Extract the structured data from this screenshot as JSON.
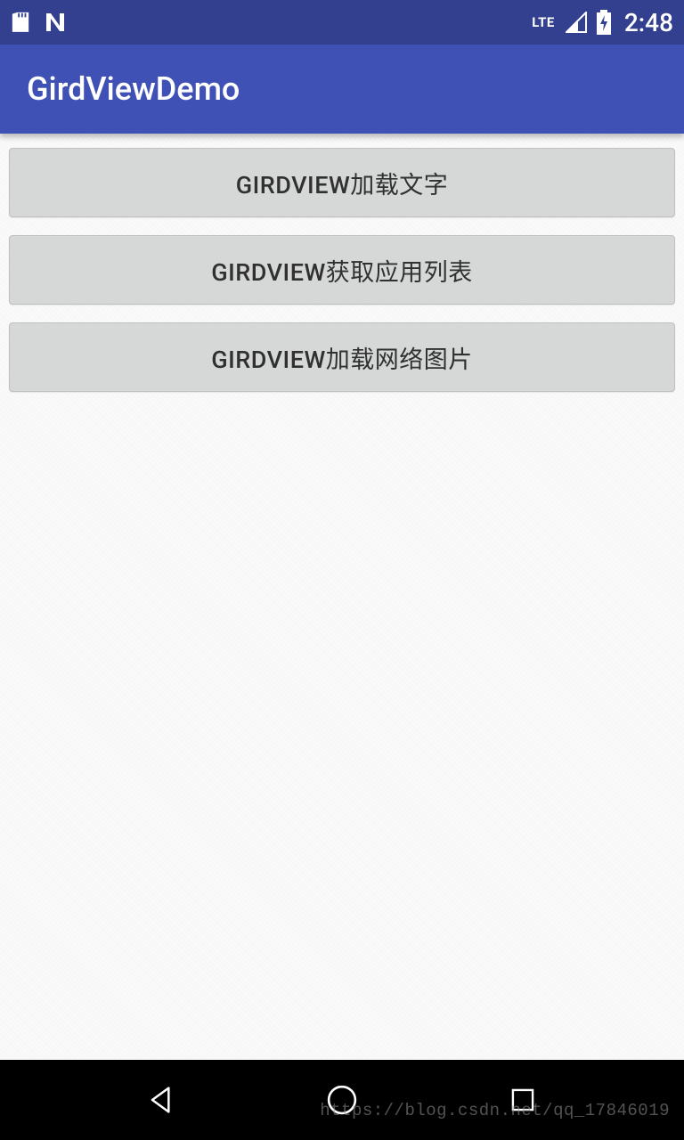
{
  "status_bar": {
    "network_label": "LTE",
    "time": "2:48"
  },
  "app_bar": {
    "title": "GirdViewDemo"
  },
  "buttons": [
    {
      "label": "GIRDVIEW加载文字"
    },
    {
      "label": "GIRDVIEW获取应用列表"
    },
    {
      "label": "GIRDVIEW加载网络图片"
    }
  ],
  "watermark": "https://blog.csdn.net/qq_17846019"
}
